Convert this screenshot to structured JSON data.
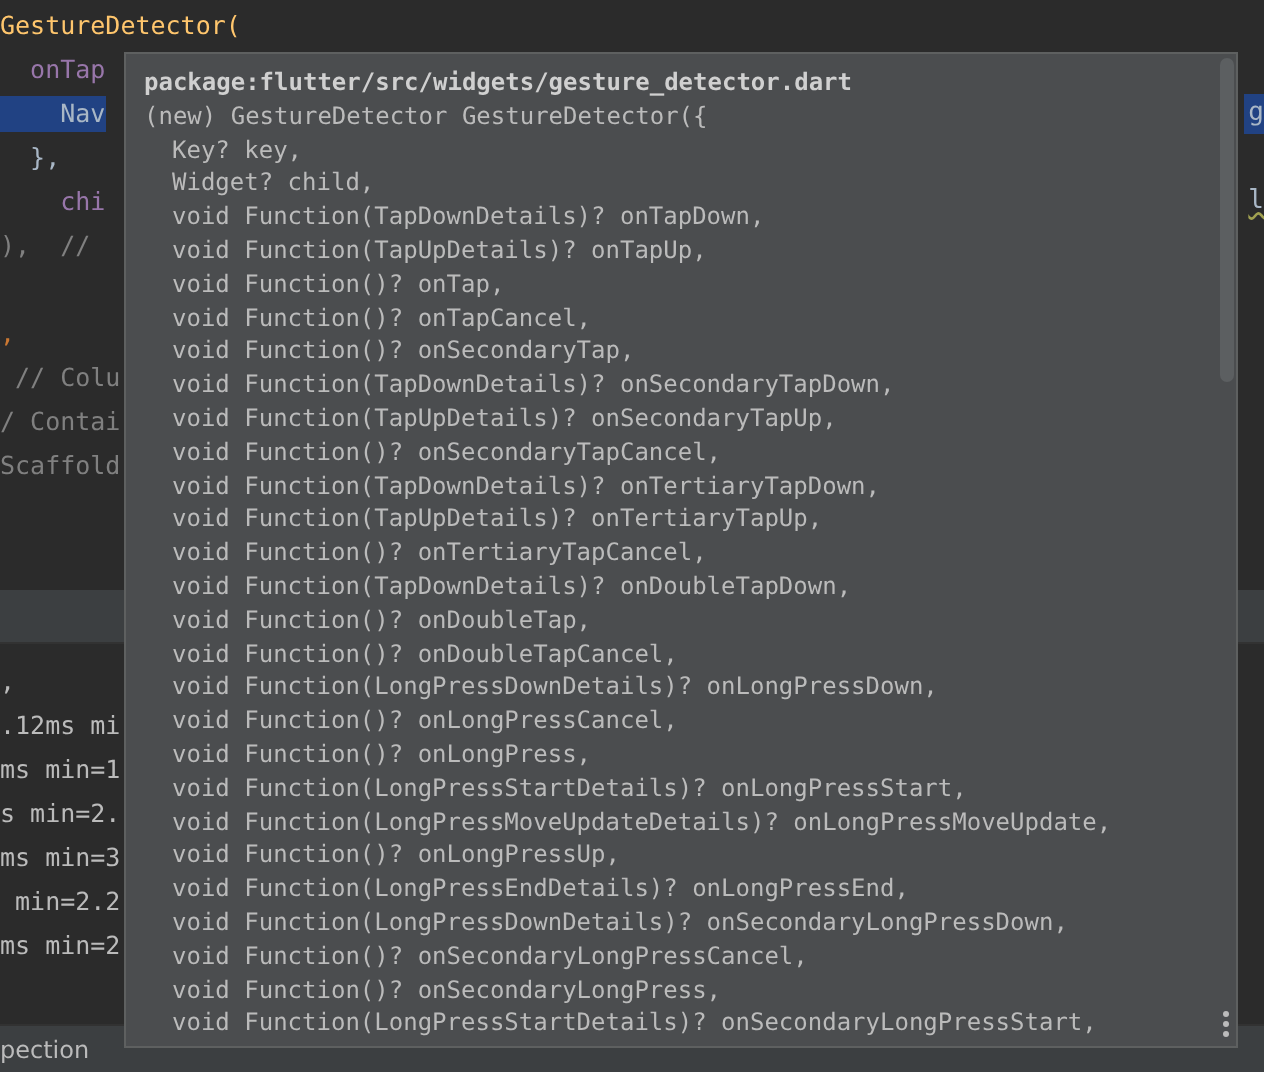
{
  "editor": {
    "lines": [
      {
        "text": "GestureDetector(",
        "kind": "call",
        "selected": false
      },
      {
        "text": "  onTap",
        "kind": "param",
        "selected": false
      },
      {
        "text": "    Nav",
        "kind": "code",
        "selected": true,
        "tail": "g"
      },
      {
        "text": "  },",
        "kind": "code",
        "selected": false
      },
      {
        "text": "    chi",
        "kind": "param",
        "selected": false,
        "tail": "l"
      },
      {
        "text": "),  //",
        "kind": "comment",
        "selected": false
      },
      {
        "kind": "blank"
      },
      {
        "text": ",",
        "kind": "punct",
        "selected": false
      },
      {
        "text": " // Colu",
        "kind": "comment",
        "selected": false
      },
      {
        "text": "/ Contai",
        "kind": "comment",
        "selected": false
      },
      {
        "text": "Scaffold",
        "kind": "comment",
        "selected": false
      }
    ]
  },
  "console": {
    "lines": [
      ",",
      ".12ms mi",
      "ms min=1",
      "s min=2.",
      "ms min=3",
      " min=2.2",
      "ms min=2"
    ]
  },
  "bottom_tabs": [
    "pection"
  ],
  "popup": {
    "header": "package:flutter/src/widgets/gesture_detector.dart",
    "signature": "(new) GestureDetector GestureDetector({",
    "params": [
      "Key? key,",
      "Widget? child,",
      "void Function(TapDownDetails)? onTapDown,",
      "void Function(TapUpDetails)? onTapUp,",
      "void Function()? onTap,",
      "void Function()? onTapCancel,",
      "void Function()? onSecondaryTap,",
      "void Function(TapDownDetails)? onSecondaryTapDown,",
      "void Function(TapUpDetails)? onSecondaryTapUp,",
      "void Function()? onSecondaryTapCancel,",
      "void Function(TapDownDetails)? onTertiaryTapDown,",
      "void Function(TapUpDetails)? onTertiaryTapUp,",
      "void Function()? onTertiaryTapCancel,",
      "void Function(TapDownDetails)? onDoubleTapDown,",
      "void Function()? onDoubleTap,",
      "void Function()? onDoubleTapCancel,",
      "void Function(LongPressDownDetails)? onLongPressDown,",
      "void Function()? onLongPressCancel,",
      "void Function()? onLongPress,",
      "void Function(LongPressStartDetails)? onLongPressStart,",
      "void Function(LongPressMoveUpdateDetails)? onLongPressMoveUpdate,",
      "void Function()? onLongPressUp,",
      "void Function(LongPressEndDetails)? onLongPressEnd,",
      "void Function(LongPressDownDetails)? onSecondaryLongPressDown,",
      "void Function()? onSecondaryLongPressCancel,",
      "void Function()? onSecondaryLongPress,",
      "void Function(LongPressStartDetails)? onSecondaryLongPressStart,"
    ]
  }
}
